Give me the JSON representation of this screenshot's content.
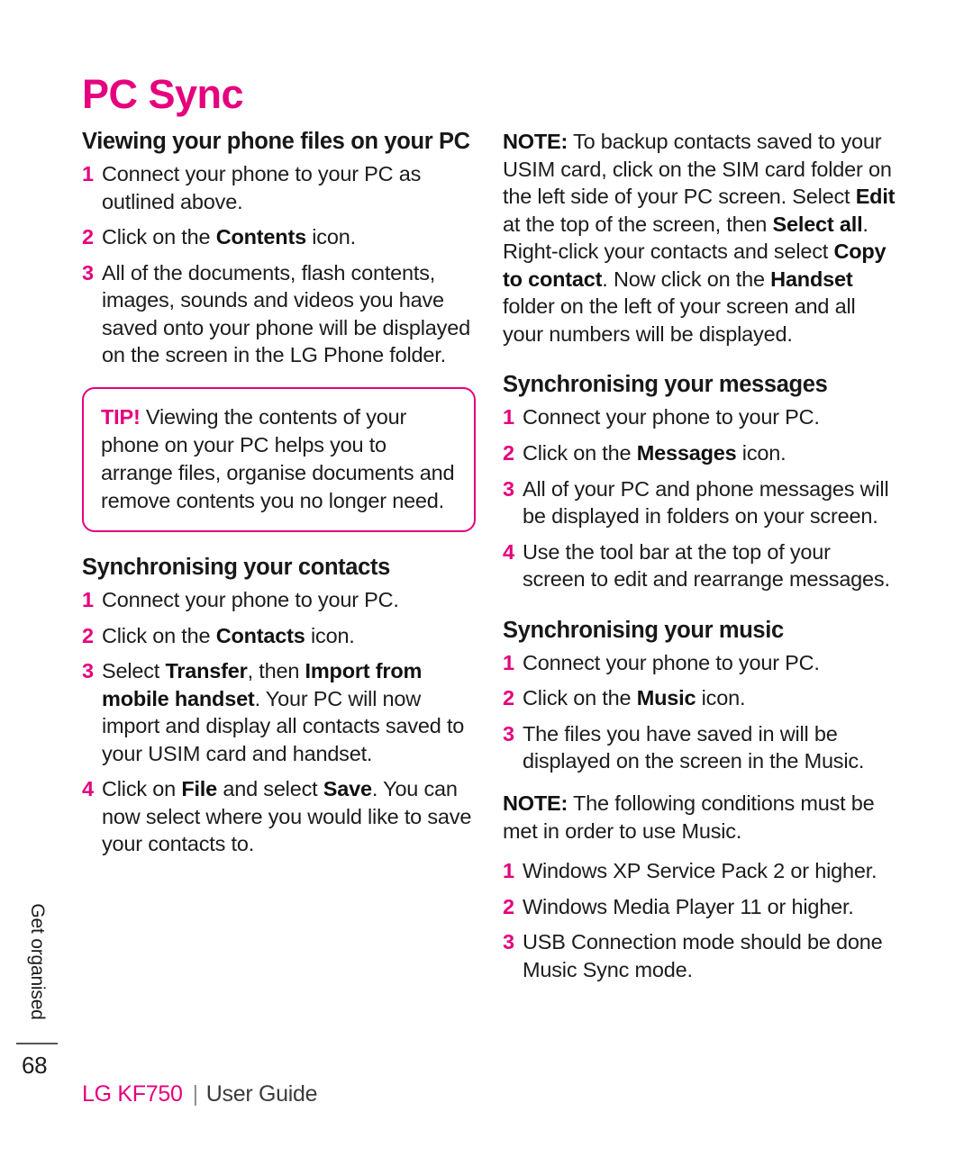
{
  "document": {
    "title": "PC Sync",
    "chapter_tab": "Get organised",
    "page_number": "68"
  },
  "colors": {
    "accent": "#e5007d",
    "body_text": "#1c1c1c",
    "footer_guide": "#3c3c3c",
    "rule": "#555555"
  },
  "left_column": {
    "section1": {
      "heading": "Viewing your phone files on your PC",
      "steps": [
        {
          "parts": [
            {
              "text": "Connect your phone to your PC as outlined above.",
              "bold": false
            }
          ]
        },
        {
          "parts": [
            {
              "text": "Click on the ",
              "bold": false
            },
            {
              "text": "Contents",
              "bold": true
            },
            {
              "text": " icon.",
              "bold": false
            }
          ]
        },
        {
          "parts": [
            {
              "text": "All of the documents, flash contents, images, sounds and videos you have saved onto your phone will be displayed on the screen in the LG Phone folder.",
              "bold": false
            }
          ]
        }
      ]
    },
    "tip_box": {
      "label": "TIP!",
      "text": " Viewing the contents of your phone on your PC helps you to arrange files, organise documents and remove contents you no longer need."
    },
    "section2": {
      "heading": "Synchronising your contacts",
      "steps": [
        {
          "parts": [
            {
              "text": "Connect your phone to your PC.",
              "bold": false
            }
          ]
        },
        {
          "parts": [
            {
              "text": "Click on the ",
              "bold": false
            },
            {
              "text": "Contacts",
              "bold": true
            },
            {
              "text": " icon.",
              "bold": false
            }
          ]
        },
        {
          "parts": [
            {
              "text": "Select ",
              "bold": false
            },
            {
              "text": "Transfer",
              "bold": true
            },
            {
              "text": ", then ",
              "bold": false
            },
            {
              "text": "Import from mobile handset",
              "bold": true
            },
            {
              "text": ". Your PC will now import and display all contacts saved to your USIM card and handset.",
              "bold": false
            }
          ]
        },
        {
          "parts": [
            {
              "text": "Click on ",
              "bold": false
            },
            {
              "text": "File",
              "bold": true
            },
            {
              "text": " and select ",
              "bold": false
            },
            {
              "text": "Save",
              "bold": true
            },
            {
              "text": ". You can now select where you would like to save your contacts to.",
              "bold": false
            }
          ]
        }
      ]
    }
  },
  "right_column": {
    "note1": {
      "parts": [
        {
          "text": "NOTE:",
          "bold": true
        },
        {
          "text": " To backup contacts saved to your USIM card, click on the SIM card folder on the left side of your PC screen. Select ",
          "bold": false
        },
        {
          "text": "Edit",
          "bold": true
        },
        {
          "text": " at the top of the screen, then ",
          "bold": false
        },
        {
          "text": "Select all",
          "bold": true
        },
        {
          "text": ". Right-click your contacts and select ",
          "bold": false
        },
        {
          "text": "Copy to contact",
          "bold": true
        },
        {
          "text": ". Now click on the ",
          "bold": false
        },
        {
          "text": "Handset",
          "bold": true
        },
        {
          "text": " folder on the left of your screen and all your numbers will be displayed.",
          "bold": false
        }
      ]
    },
    "section_messages": {
      "heading": "Synchronising your messages",
      "steps": [
        {
          "parts": [
            {
              "text": "Connect your phone to your PC.",
              "bold": false
            }
          ]
        },
        {
          "parts": [
            {
              "text": "Click on the ",
              "bold": false
            },
            {
              "text": "Messages",
              "bold": true
            },
            {
              "text": " icon.",
              "bold": false
            }
          ]
        },
        {
          "parts": [
            {
              "text": "All of your PC and phone messages will be displayed in folders on your screen.",
              "bold": false
            }
          ]
        },
        {
          "parts": [
            {
              "text": "Use the tool bar at the top of your screen to edit and rearrange messages.",
              "bold": false
            }
          ]
        }
      ]
    },
    "section_music": {
      "heading": "Synchronising your music",
      "steps": [
        {
          "parts": [
            {
              "text": "Connect your phone to your PC.",
              "bold": false
            }
          ]
        },
        {
          "parts": [
            {
              "text": "Click on the ",
              "bold": false
            },
            {
              "text": "Music",
              "bold": true
            },
            {
              "text": " icon.",
              "bold": false
            }
          ]
        },
        {
          "parts": [
            {
              "text": "The files you have saved in will be displayed on the screen in the Music.",
              "bold": false
            }
          ]
        }
      ]
    },
    "note2": {
      "parts": [
        {
          "text": "NOTE:",
          "bold": true
        },
        {
          "text": " The following conditions must be met in order to use Music.",
          "bold": false
        }
      ]
    },
    "conditions": [
      {
        "parts": [
          {
            "text": "Windows XP Service Pack 2 or higher.",
            "bold": false
          }
        ]
      },
      {
        "parts": [
          {
            "text": "Windows Media Player 11 or higher.",
            "bold": false
          }
        ]
      },
      {
        "parts": [
          {
            "text": "USB Connection mode should be done Music Sync mode.",
            "bold": false
          }
        ]
      }
    ]
  },
  "footer": {
    "brand": "LG KF750",
    "divider": "|",
    "guide": "User Guide"
  }
}
